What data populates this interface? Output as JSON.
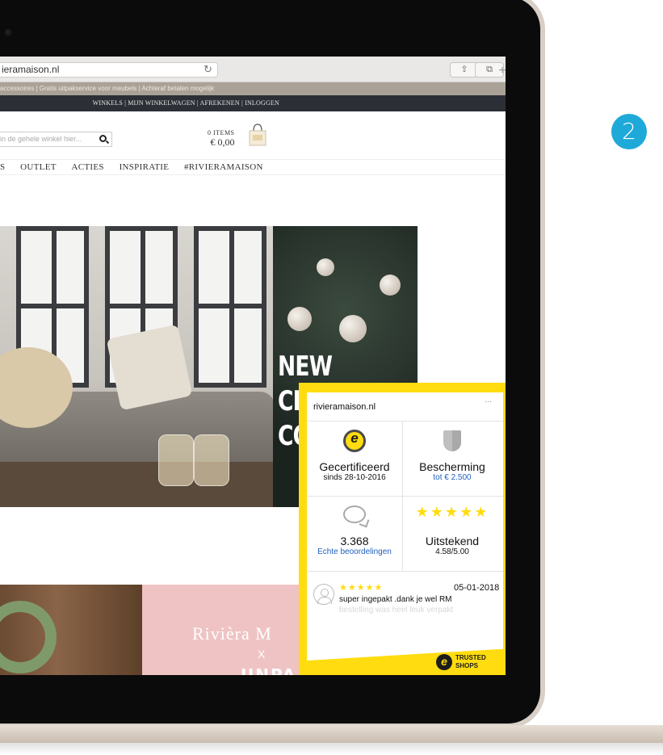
{
  "browser": {
    "url": "ieramaison.nl",
    "reload_icon": "reload-icon",
    "share_icon": "share-icon",
    "tabs_icon": "tabs-icon",
    "new_tab_icon": "plus-icon"
  },
  "site": {
    "promo_bar": "accessoires  |  Gratis uitpakservice voor meubels  |  Achteraf betalen mogelijk",
    "account_bar": "WINKELS  |  MIJN WINKELWAGEN  |  AFREKENEN  |  INLOGGEN",
    "search_placeholder": "in de gehele winkel hier...",
    "cart_items": "0 ITEMS",
    "cart_total": "€ 0,00",
    "nav": [
      "S",
      "OUTLET",
      "ACTIES",
      "INSPIRATIE",
      "#RIVIERAMAISON"
    ],
    "hero_headline_lines": [
      "NEW",
      "CH",
      "COL"
    ],
    "pink_banner_title": "Rivièra M",
    "pink_banner_x": "X",
    "pink_banner_sub": "UNPA"
  },
  "trusted_shops": {
    "domain": "rivieramaison.nl",
    "menu": "...",
    "certified_title": "Gecertificeerd",
    "certified_since": "sinds 28-10-2016",
    "protection_title": "Bescherming",
    "protection_amount": "tot € 2.500",
    "reviews_count": "3.368",
    "reviews_label": "Echte beoordelingen",
    "rating_stars": "★★★★★",
    "rating_label": "Uitstekend",
    "rating_score": "4.58/5.00",
    "review_stars": "★★★★★",
    "review_date": "05-01-2018",
    "review_text": "super ingepakt .dank je wel RM",
    "review_text_faded": "bestelling was heel leuk verpakt",
    "logo_e": "e",
    "logo_line1": "TRUSTED",
    "logo_line2": "SHOPS",
    "accent_color": "#ffdc0f"
  },
  "step_badge": "2"
}
